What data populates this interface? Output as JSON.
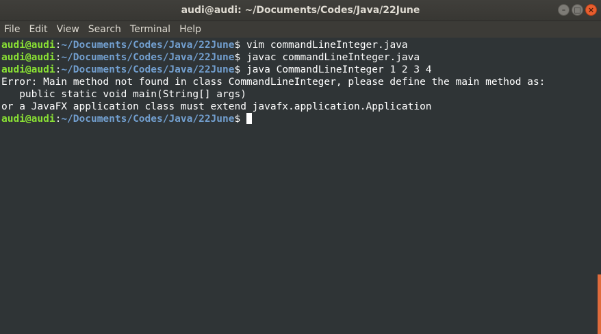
{
  "window": {
    "title": "audi@audi: ~/Documents/Codes/Java/22June"
  },
  "menu": [
    "File",
    "Edit",
    "View",
    "Search",
    "Terminal",
    "Help"
  ],
  "prompt": {
    "user_host": "audi@audi",
    "colon": ":",
    "path": "~/Documents/Codes/Java/22June",
    "symbol": "$"
  },
  "lines": {
    "cmd1": " vim commandLineInteger.java",
    "cmd2": " javac commandLineInteger.java",
    "cmd3": " java CommandLineInteger 1 2 3 4",
    "err1": "Error: Main method not found in class CommandLineInteger, please define the main method as:",
    "err2": "   public static void main(String[] args)",
    "err3": "or a JavaFX application class must extend javafx.application.Application",
    "cmd4": " "
  },
  "colors": {
    "background": "#2f3436",
    "prompt_user": "#8ae234",
    "prompt_path": "#729fcf",
    "close_button": "#e95e2e"
  }
}
